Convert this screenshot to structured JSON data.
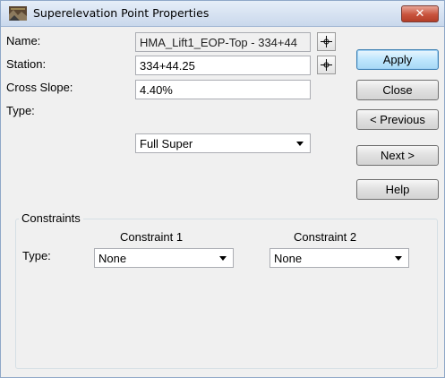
{
  "window": {
    "title": "Superelevation Point Properties",
    "close_glyph": "✕",
    "accent_color": "#c8533d"
  },
  "form": {
    "name_label": "Name:",
    "name_value": "HMA_Lift1_EOP-Top - 334+44",
    "station_label": "Station:",
    "station_value": "334+44.25",
    "cross_slope_label": "Cross Slope:",
    "cross_slope_value": "4.40%",
    "type_label": "Type:",
    "type_value": "Full Super"
  },
  "buttons": {
    "apply": "Apply",
    "close": "Close",
    "previous": "< Previous",
    "next": "Next >",
    "help": "Help"
  },
  "constraints": {
    "group_label": "Constraints",
    "type_label": "Type:",
    "constraint1_header": "Constraint 1",
    "constraint1_value": "None",
    "constraint2_header": "Constraint 2",
    "constraint2_value": "None"
  },
  "icons": {
    "app": "road-profile-icon",
    "pick": "crosshair-icon",
    "dropdown": "chevron-down-icon"
  }
}
